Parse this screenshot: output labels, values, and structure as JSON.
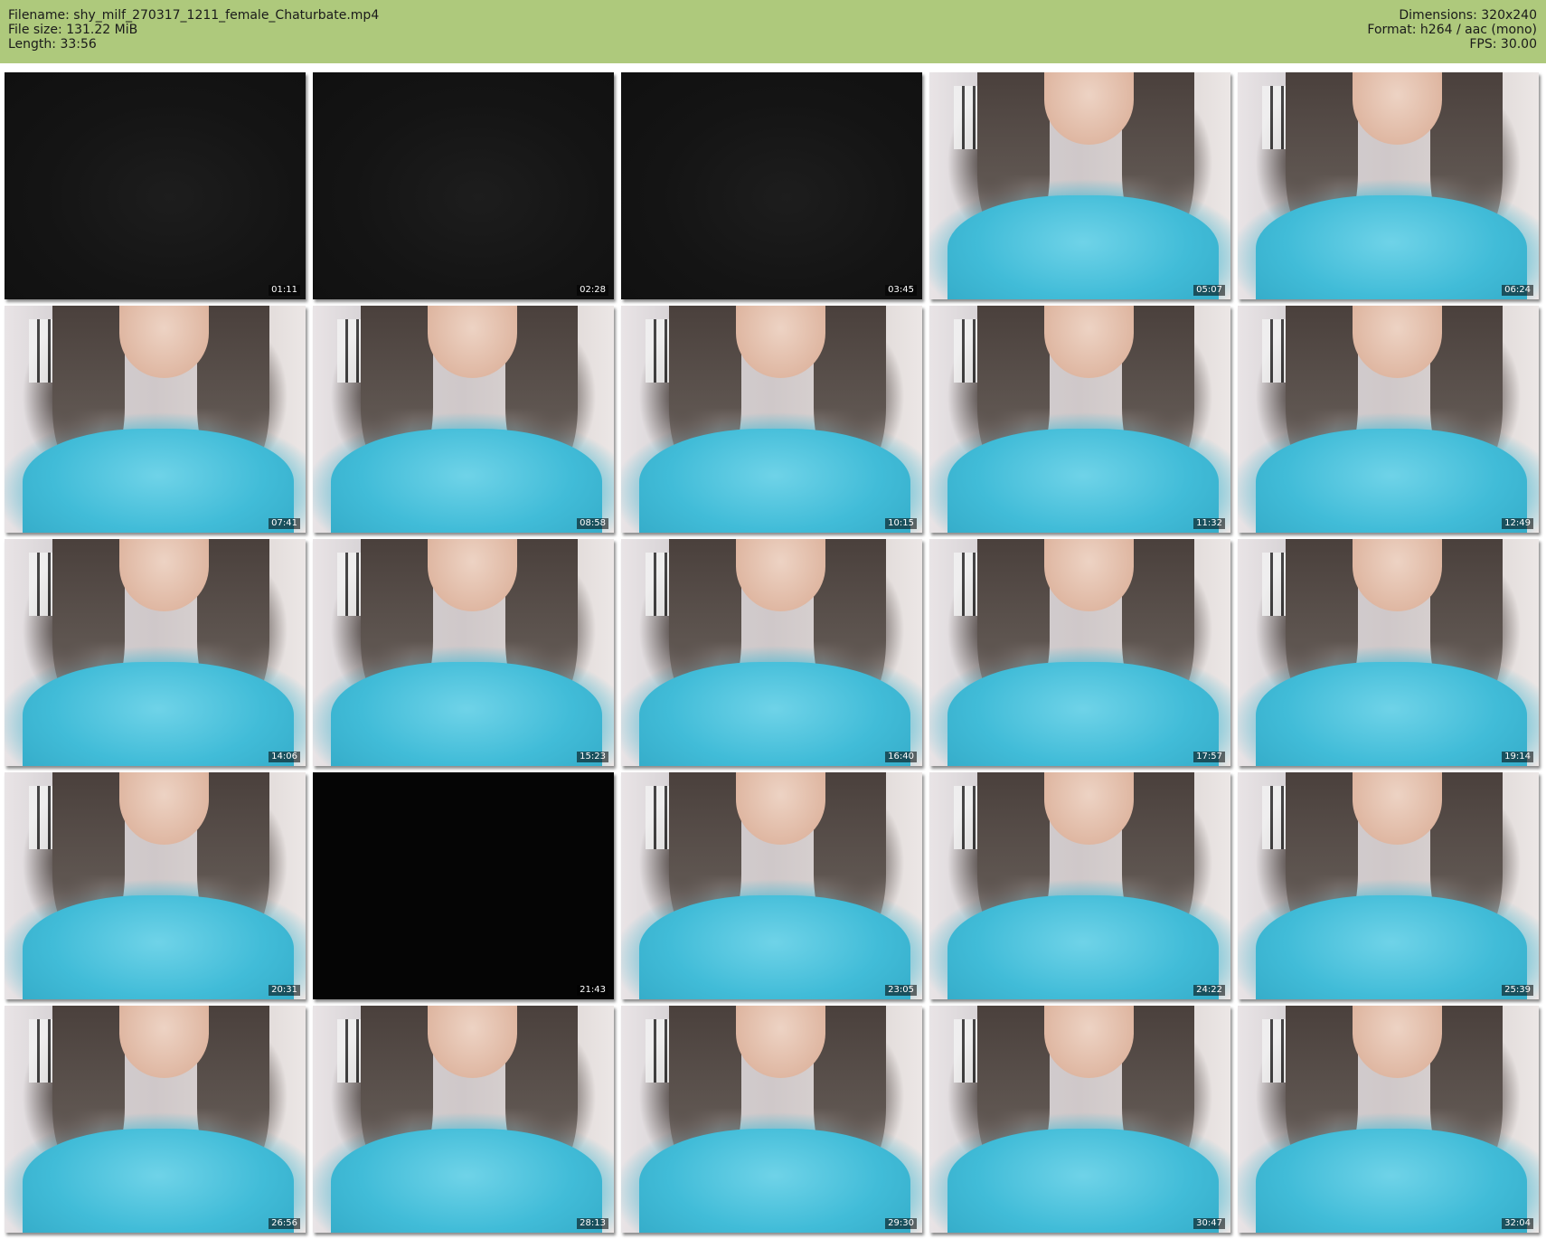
{
  "header": {
    "filename": "Filename: shy_milf_270317_1211_female_Chaturbate.mp4",
    "file_size": "File size: 131.22 MiB",
    "length": "Length: 33:56",
    "dimensions": "Dimensions: 320x240",
    "format": "Format: h264 / aac (mono)",
    "fps": "FPS: 30.00"
  },
  "colors": {
    "header_bg": "#aec97c",
    "shirt": "#41bcd8"
  },
  "thumbnails": [
    {
      "time": "01:11",
      "frame": "dark"
    },
    {
      "time": "02:28",
      "frame": "dark"
    },
    {
      "time": "03:45",
      "frame": "dark"
    },
    {
      "time": "05:07",
      "frame": "scene"
    },
    {
      "time": "06:24",
      "frame": "scene"
    },
    {
      "time": "07:41",
      "frame": "scene"
    },
    {
      "time": "08:58",
      "frame": "scene"
    },
    {
      "time": "10:15",
      "frame": "scene"
    },
    {
      "time": "11:32",
      "frame": "scene"
    },
    {
      "time": "12:49",
      "frame": "scene"
    },
    {
      "time": "14:06",
      "frame": "scene"
    },
    {
      "time": "15:23",
      "frame": "scene"
    },
    {
      "time": "16:40",
      "frame": "scene"
    },
    {
      "time": "17:57",
      "frame": "scene"
    },
    {
      "time": "19:14",
      "frame": "scene"
    },
    {
      "time": "20:31",
      "frame": "scene"
    },
    {
      "time": "21:43",
      "frame": "black"
    },
    {
      "time": "23:05",
      "frame": "scene"
    },
    {
      "time": "24:22",
      "frame": "scene"
    },
    {
      "time": "25:39",
      "frame": "scene"
    },
    {
      "time": "26:56",
      "frame": "scene"
    },
    {
      "time": "28:13",
      "frame": "scene"
    },
    {
      "time": "29:30",
      "frame": "scene"
    },
    {
      "time": "30:47",
      "frame": "scene"
    },
    {
      "time": "32:04",
      "frame": "scene"
    }
  ]
}
